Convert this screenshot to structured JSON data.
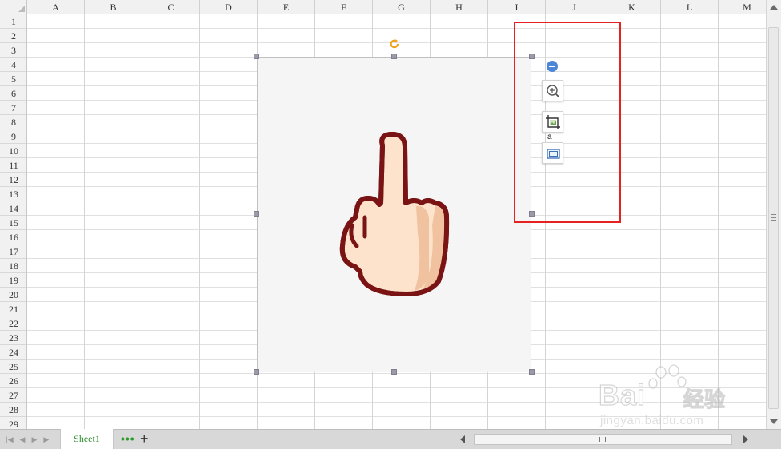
{
  "spreadsheet": {
    "columns": [
      "A",
      "B",
      "C",
      "D",
      "E",
      "F",
      "G",
      "H",
      "I",
      "J",
      "K",
      "L",
      "M"
    ],
    "rows": [
      "1",
      "2",
      "3",
      "4",
      "5",
      "6",
      "7",
      "8",
      "9",
      "10",
      "11",
      "12",
      "13",
      "14",
      "15",
      "16",
      "17",
      "18",
      "19",
      "20",
      "21",
      "22",
      "23",
      "24",
      "25",
      "26",
      "27",
      "28",
      "29"
    ]
  },
  "sheet_tabs": {
    "active": "Sheet1",
    "more_label": "•••",
    "add_label": "+"
  },
  "picture": {
    "icon": "middle-finger-hand-icon"
  },
  "quick_tools": {
    "collapse_icon": "collapse-icon",
    "zoom_icon": "zoom-in-icon",
    "crop_icon": "crop-image-icon",
    "fit_icon": "fit-frame-icon",
    "caption": "a"
  },
  "annotation": {
    "color": "#e52222"
  },
  "watermark": {
    "brand": "Bai",
    "brand_cn": "经验",
    "url": "jingyan.baidu.com"
  },
  "colors": {
    "sheet_tab_text": "#2f8f2f",
    "handle": "#9a9aa8",
    "rotate": "#f0a21c",
    "collapse": "#4d86d6"
  }
}
